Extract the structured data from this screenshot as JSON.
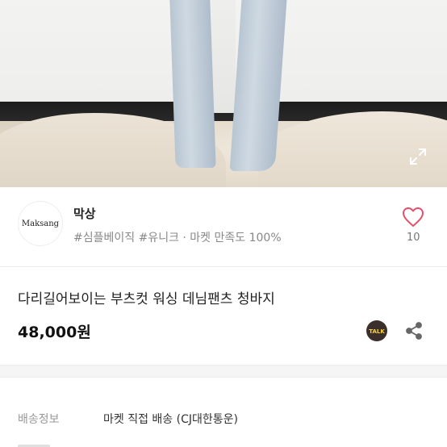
{
  "photo": {
    "alt_icon": "expand-icon"
  },
  "seller": {
    "avatar_text": "Maksang",
    "name": "막상",
    "tags": "#심플베이직 #유니크 · 마켓 만족도 100%",
    "like_count": "10"
  },
  "product": {
    "title": "다리길어보이는 부츠컷 워싱 데님팬츠 청바지",
    "price": "48,000원",
    "talk_label": "TALK"
  },
  "shipping": {
    "label": "배송정보",
    "value": "마켓 직접 배송 (CJ대한통운)"
  },
  "colors": {
    "heart": "#e0526b",
    "talk_bg": "#3a2f2a",
    "talk_fg": "#f5d33b"
  }
}
